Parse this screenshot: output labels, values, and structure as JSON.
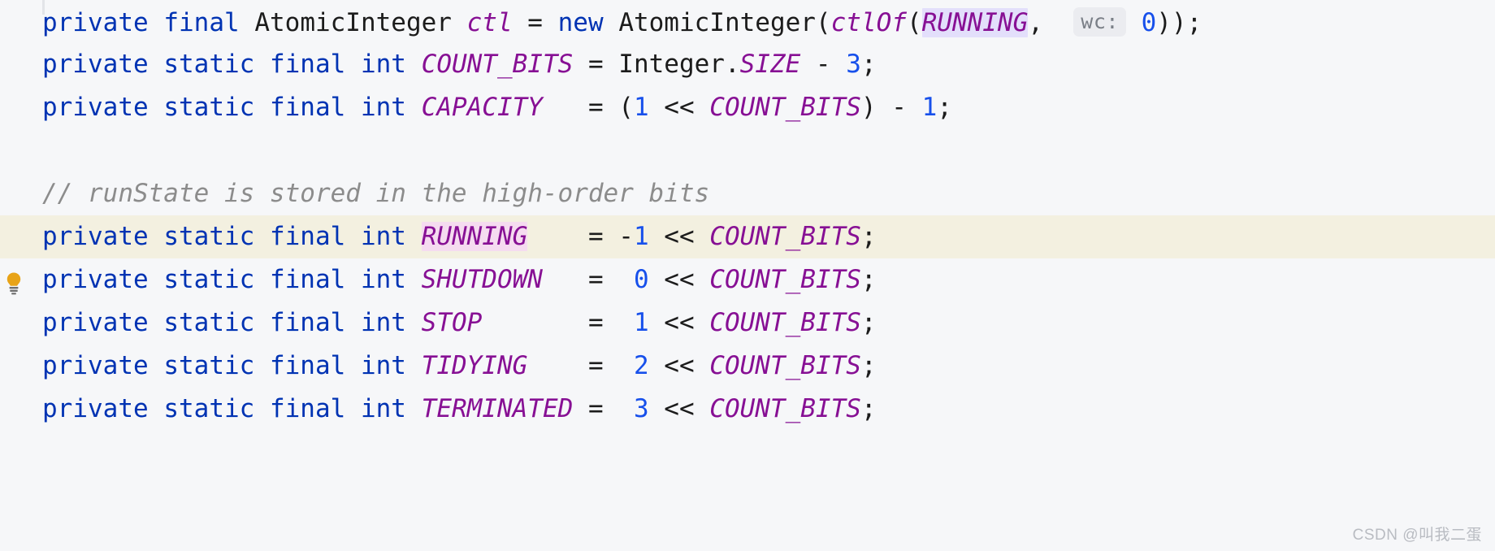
{
  "editor": {
    "language": "Java",
    "background_color": "#f6f7f9",
    "caret_line_color": "#f3f0e0",
    "keyword_color": "#0033b3",
    "static_field_color": "#871094",
    "number_color": "#1750eb",
    "comment_color": "#8c8c8c",
    "plain_text_color": "#1c1c1c",
    "usage_highlight_color": "#e3dffb",
    "declaration_highlight_color": "#f5dbf0",
    "inlay_hint_background": "#ebecf0",
    "inlay_hint_color": "#7a7f87"
  },
  "gutter": {
    "bulb_icon": "lightbulb-icon",
    "bulb_tooltip": "Show Context Actions",
    "indent_guide": "indent-guide"
  },
  "lines": [
    {
      "id": "line-ctl",
      "caret": false,
      "tokens": [
        {
          "t": "private",
          "c": "kw"
        },
        {
          "t": " ",
          "c": "plain"
        },
        {
          "t": "final",
          "c": "kw"
        },
        {
          "t": " ",
          "c": "plain"
        },
        {
          "t": "AtomicInteger",
          "c": "plain"
        },
        {
          "t": " ",
          "c": "plain"
        },
        {
          "t": "ctl",
          "c": "field"
        },
        {
          "t": " = ",
          "c": "plain"
        },
        {
          "t": "new",
          "c": "kw"
        },
        {
          "t": " ",
          "c": "plain"
        },
        {
          "t": "AtomicInteger(",
          "c": "plain"
        },
        {
          "t": "ctlOf",
          "c": "field"
        },
        {
          "t": "(",
          "c": "plain"
        },
        {
          "t": "RUNNING",
          "c": "static",
          "hl": "usage"
        },
        {
          "t": ",  ",
          "c": "plain"
        },
        {
          "t": "wc:",
          "c": "inlay"
        },
        {
          "t": " ",
          "c": "plain"
        },
        {
          "t": "0",
          "c": "num"
        },
        {
          "t": "));",
          "c": "plain"
        }
      ]
    },
    {
      "id": "line-count-bits",
      "caret": false,
      "tokens": [
        {
          "t": "private",
          "c": "kw"
        },
        {
          "t": " ",
          "c": "plain"
        },
        {
          "t": "static",
          "c": "kw"
        },
        {
          "t": " ",
          "c": "plain"
        },
        {
          "t": "final",
          "c": "kw"
        },
        {
          "t": " ",
          "c": "plain"
        },
        {
          "t": "int",
          "c": "kw"
        },
        {
          "t": " ",
          "c": "plain"
        },
        {
          "t": "COUNT_BITS",
          "c": "static"
        },
        {
          "t": " = ",
          "c": "plain"
        },
        {
          "t": "Integer.",
          "c": "plain"
        },
        {
          "t": "SIZE",
          "c": "static"
        },
        {
          "t": " - ",
          "c": "plain"
        },
        {
          "t": "3",
          "c": "num"
        },
        {
          "t": ";",
          "c": "plain"
        }
      ]
    },
    {
      "id": "line-capacity",
      "caret": false,
      "tokens": [
        {
          "t": "private",
          "c": "kw"
        },
        {
          "t": " ",
          "c": "plain"
        },
        {
          "t": "static",
          "c": "kw"
        },
        {
          "t": " ",
          "c": "plain"
        },
        {
          "t": "final",
          "c": "kw"
        },
        {
          "t": " ",
          "c": "plain"
        },
        {
          "t": "int",
          "c": "kw"
        },
        {
          "t": " ",
          "c": "plain"
        },
        {
          "t": "CAPACITY",
          "c": "static"
        },
        {
          "t": "   = (",
          "c": "plain"
        },
        {
          "t": "1",
          "c": "num"
        },
        {
          "t": " << ",
          "c": "plain"
        },
        {
          "t": "COUNT_BITS",
          "c": "static"
        },
        {
          "t": ") - ",
          "c": "plain"
        },
        {
          "t": "1",
          "c": "num"
        },
        {
          "t": ";",
          "c": "plain"
        }
      ]
    },
    {
      "id": "line-blank",
      "caret": false,
      "blank": true,
      "tokens": []
    },
    {
      "id": "line-comment",
      "caret": false,
      "tokens": [
        {
          "t": "// runState is stored in the high-order bits",
          "c": "comment"
        }
      ]
    },
    {
      "id": "line-running",
      "caret": true,
      "tokens": [
        {
          "t": "private",
          "c": "kw"
        },
        {
          "t": " ",
          "c": "plain"
        },
        {
          "t": "static",
          "c": "kw"
        },
        {
          "t": " ",
          "c": "plain"
        },
        {
          "t": "final",
          "c": "kw"
        },
        {
          "t": " ",
          "c": "plain"
        },
        {
          "t": "int",
          "c": "kw"
        },
        {
          "t": " ",
          "c": "plain"
        },
        {
          "t": "RUNNING",
          "c": "static",
          "hl": "decl"
        },
        {
          "t": "    = -",
          "c": "plain"
        },
        {
          "t": "1",
          "c": "num"
        },
        {
          "t": " << ",
          "c": "plain"
        },
        {
          "t": "COUNT_BITS",
          "c": "static"
        },
        {
          "t": ";",
          "c": "plain"
        }
      ]
    },
    {
      "id": "line-shutdown",
      "caret": false,
      "tokens": [
        {
          "t": "private",
          "c": "kw"
        },
        {
          "t": " ",
          "c": "plain"
        },
        {
          "t": "static",
          "c": "kw"
        },
        {
          "t": " ",
          "c": "plain"
        },
        {
          "t": "final",
          "c": "kw"
        },
        {
          "t": " ",
          "c": "plain"
        },
        {
          "t": "int",
          "c": "kw"
        },
        {
          "t": " ",
          "c": "plain"
        },
        {
          "t": "SHUTDOWN",
          "c": "static"
        },
        {
          "t": "   =  ",
          "c": "plain"
        },
        {
          "t": "0",
          "c": "num"
        },
        {
          "t": " << ",
          "c": "plain"
        },
        {
          "t": "COUNT_BITS",
          "c": "static"
        },
        {
          "t": ";",
          "c": "plain"
        }
      ]
    },
    {
      "id": "line-stop",
      "caret": false,
      "tokens": [
        {
          "t": "private",
          "c": "kw"
        },
        {
          "t": " ",
          "c": "plain"
        },
        {
          "t": "static",
          "c": "kw"
        },
        {
          "t": " ",
          "c": "plain"
        },
        {
          "t": "final",
          "c": "kw"
        },
        {
          "t": " ",
          "c": "plain"
        },
        {
          "t": "int",
          "c": "kw"
        },
        {
          "t": " ",
          "c": "plain"
        },
        {
          "t": "STOP",
          "c": "static"
        },
        {
          "t": "       =  ",
          "c": "plain"
        },
        {
          "t": "1",
          "c": "num"
        },
        {
          "t": " << ",
          "c": "plain"
        },
        {
          "t": "COUNT_BITS",
          "c": "static"
        },
        {
          "t": ";",
          "c": "plain"
        }
      ]
    },
    {
      "id": "line-tidying",
      "caret": false,
      "tokens": [
        {
          "t": "private",
          "c": "kw"
        },
        {
          "t": " ",
          "c": "plain"
        },
        {
          "t": "static",
          "c": "kw"
        },
        {
          "t": " ",
          "c": "plain"
        },
        {
          "t": "final",
          "c": "kw"
        },
        {
          "t": " ",
          "c": "plain"
        },
        {
          "t": "int",
          "c": "kw"
        },
        {
          "t": " ",
          "c": "plain"
        },
        {
          "t": "TIDYING",
          "c": "static"
        },
        {
          "t": "    =  ",
          "c": "plain"
        },
        {
          "t": "2",
          "c": "num"
        },
        {
          "t": " << ",
          "c": "plain"
        },
        {
          "t": "COUNT_BITS",
          "c": "static"
        },
        {
          "t": ";",
          "c": "plain"
        }
      ]
    },
    {
      "id": "line-terminated",
      "caret": false,
      "tokens": [
        {
          "t": "private",
          "c": "kw"
        },
        {
          "t": " ",
          "c": "plain"
        },
        {
          "t": "static",
          "c": "kw"
        },
        {
          "t": " ",
          "c": "plain"
        },
        {
          "t": "final",
          "c": "kw"
        },
        {
          "t": " ",
          "c": "plain"
        },
        {
          "t": "int",
          "c": "kw"
        },
        {
          "t": " ",
          "c": "plain"
        },
        {
          "t": "TERMINATED",
          "c": "static"
        },
        {
          "t": " =  ",
          "c": "plain"
        },
        {
          "t": "3",
          "c": "num"
        },
        {
          "t": " << ",
          "c": "plain"
        },
        {
          "t": "COUNT_BITS",
          "c": "static"
        },
        {
          "t": ";",
          "c": "plain"
        }
      ]
    }
  ],
  "watermark": {
    "text": "CSDN @叫我二蛋"
  }
}
